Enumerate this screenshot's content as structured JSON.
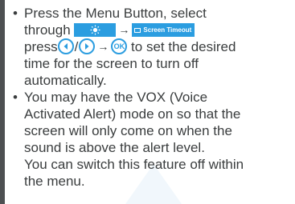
{
  "bullet_symbol": "•",
  "item1": {
    "line1": "Press the Menu Button, select",
    "line2_prefix": "through",
    "brightness_icon": "sun-icon",
    "arrow": "→",
    "screen_timeout_icon": "screen-icon",
    "screen_timeout_label": "Screen Timeout",
    "line3_prefix": "press",
    "left_button_icon": "left-arrow-icon",
    "slash": "/",
    "right_button_icon": "right-arrow-icon",
    "ok_label": "OK",
    "line3_suffix": "to set the desired",
    "line4": "time for the screen to turn off",
    "line5": "automatically."
  },
  "item2": {
    "line1": "You may have the VOX (Voice",
    "line2": "Activated Alert) mode on so that the",
    "line3": "screen will only come on when the",
    "line4": "sound is above the alert level.",
    "line5": "You can switch this feature off within",
    "line6": "the menu."
  },
  "colors": {
    "text": "#3a3d3e",
    "accent": "#2b9de0",
    "sidebar": "#4d5052",
    "background": "#ffffff"
  }
}
